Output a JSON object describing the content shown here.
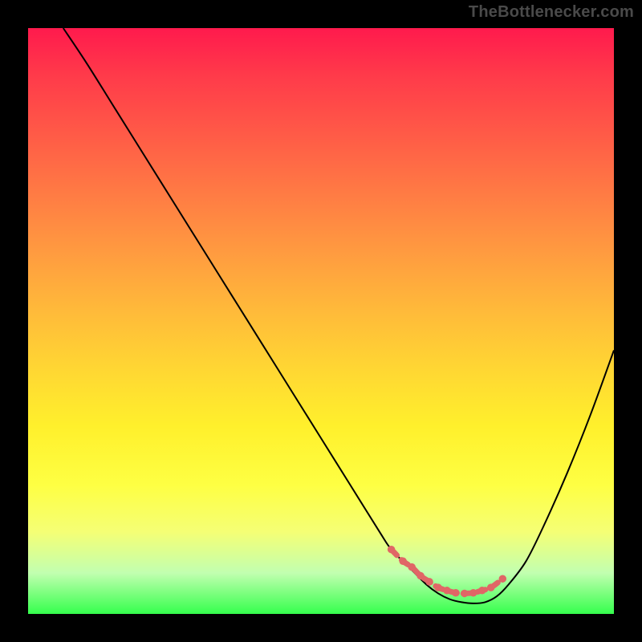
{
  "attribution": "TheBottlenecker.com",
  "colors": {
    "background": "#000000",
    "curve": "#000000",
    "marker": "#e06666",
    "gradient_top": "#ff1a4d",
    "gradient_bottom": "#35ff4d"
  },
  "chart_data": {
    "type": "line",
    "title": "",
    "xlabel": "",
    "ylabel": "",
    "xlim": [
      0,
      100
    ],
    "ylim": [
      0,
      100
    ],
    "series": [
      {
        "name": "bottleneck-curve",
        "x": [
          6,
          10,
          15,
          20,
          25,
          30,
          35,
          40,
          45,
          50,
          55,
          60,
          62,
          65,
          68,
          70,
          72,
          74,
          76,
          78,
          80,
          82,
          85,
          88,
          92,
          96,
          100
        ],
        "y": [
          100,
          94,
          86,
          78,
          70,
          62,
          54,
          46,
          38,
          30,
          22,
          14,
          11,
          8,
          5,
          3.5,
          2.5,
          2,
          1.8,
          2,
          3,
          5,
          9,
          15,
          24,
          34,
          45
        ]
      }
    ],
    "markers": {
      "name": "optimal-range",
      "x": [
        62,
        64,
        65.5,
        67,
        68.5,
        70,
        71.5,
        73,
        74.5,
        76,
        77.5,
        79,
        81
      ],
      "y": [
        11,
        9,
        8,
        6.5,
        5.5,
        4.5,
        4,
        3.6,
        3.5,
        3.6,
        4,
        4.5,
        6
      ]
    },
    "annotations": []
  }
}
